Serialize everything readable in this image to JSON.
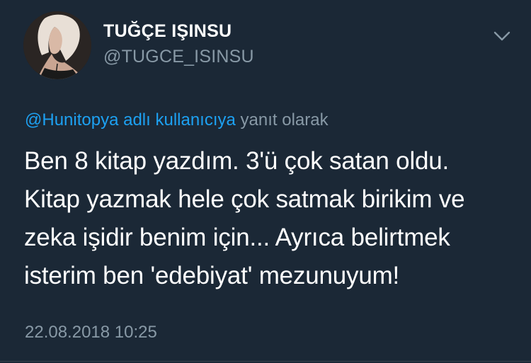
{
  "user": {
    "display_name": "TUĞÇE IŞINSU",
    "handle": "@TUGCE_ISINSU"
  },
  "reply": {
    "mention": "@Hunitopya adlı kullanıcıya",
    "suffix": "yanıt olarak"
  },
  "tweet": {
    "lines": [
      "Ben 8 kitap yazdım. 3'ü çok satan oldu.",
      "Kitap yazmak hele çok satmak birikim ve",
      "zeka işidir benim için... Ayrıca belirtmek",
      "isterim ben 'edebiyat' mezunuyum!"
    ],
    "timestamp": "22.08.2018 10:25"
  },
  "icons": {
    "menu": "chevron-down-icon",
    "avatar": "profile-photo"
  },
  "colors": {
    "background": "#1b2836",
    "accent": "#1da1f2",
    "secondary_text": "#8899a6",
    "primary_text": "#ffffff"
  }
}
